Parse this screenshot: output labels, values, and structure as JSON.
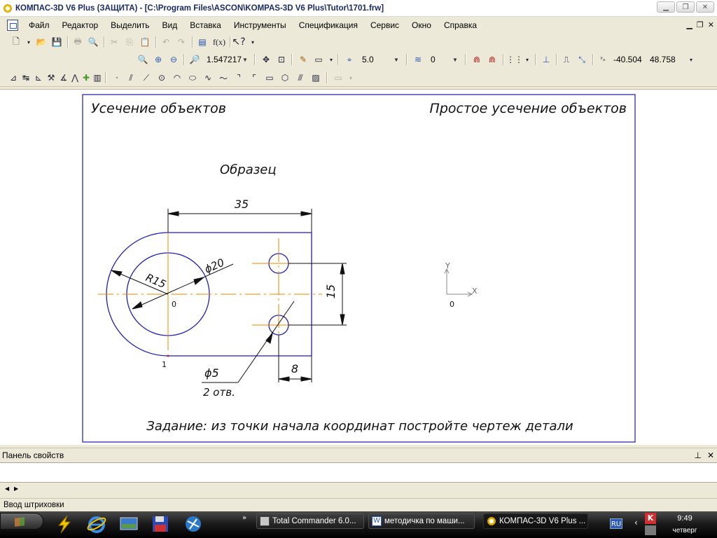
{
  "window": {
    "title": "КОМПАС-3D V6 Plus (ЗАЩИТА) - [C:\\Program Files\\ASCON\\KOMPAS-3D V6 Plus\\Tutor\\1701.frw]"
  },
  "menu": {
    "items": [
      "Файл",
      "Редактор",
      "Выделить",
      "Вид",
      "Вставка",
      "Инструменты",
      "Спецификация",
      "Сервис",
      "Окно",
      "Справка"
    ]
  },
  "toolbar": {
    "zoom_value": "1.547217",
    "step_value": "5.0",
    "layer_value": "0",
    "coord_x": "-40.504",
    "coord_y": "48.758",
    "function_label": "f(x)"
  },
  "drawing": {
    "title_left": "Усечение объектов",
    "title_right": "Простое усечение объектов",
    "sample_label": "Образец",
    "dim_35": "35",
    "dim_15": "15",
    "dim_8": "8",
    "dim_r15": "R15",
    "dim_d20": "ϕ20",
    "dim_d5": "ϕ5",
    "holes_note": "2 отв.",
    "origin_label": "0",
    "point_label": "1",
    "axis_x": "X",
    "axis_y": "Y",
    "axis_origin": "0",
    "task_text": "Задание: из точки начала координат постройте чертеж детали"
  },
  "panel": {
    "title": "Панель свойств"
  },
  "status": {
    "text": "Ввод штриховки"
  },
  "taskbar": {
    "tasks": [
      "Total Commander 6.0...",
      "методичка по маши...",
      "КОМПАС-3D V6 Plus ..."
    ],
    "lang": "RU",
    "time": "9:49",
    "day": "четверг"
  }
}
